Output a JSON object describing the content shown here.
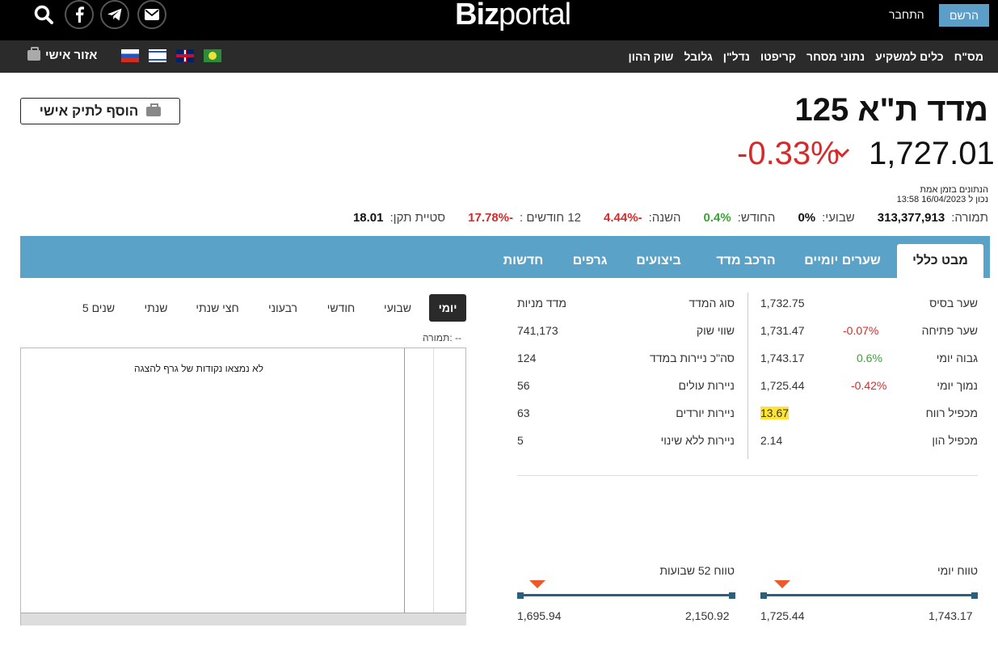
{
  "header": {
    "logo_bold": "Biz",
    "logo_light": "portal",
    "login": "התחבר",
    "register": "הרשם",
    "icons": [
      "search-icon",
      "facebook-icon",
      "telegram-icon",
      "email-icon"
    ]
  },
  "nav": {
    "items": [
      "שוק ההון",
      "גלובל",
      "נדל\"ן",
      "קריפטו",
      "נתוני מסחר",
      "כלים למשקיע",
      "מס\"ח"
    ],
    "personal_area": "אזור אישי"
  },
  "title": {
    "name": "מדד ת\"א 125",
    "add_portfolio": "הוסף לתיק אישי",
    "price": "1,727.01",
    "change": "-0.33%",
    "realtime_line1": "הנתונים בזמן אמת",
    "realtime_line2": "נכון ל 16/04/2023 13:58"
  },
  "stats": {
    "volume_label": "תמורה:",
    "volume": "313,377,913",
    "weekly_label": "שבועי:",
    "weekly": "0%",
    "monthly_label": "החודש:",
    "monthly": "0.4%",
    "year_label": "השנה:",
    "year": "-4.44%",
    "months12_label": "12 חודשים :",
    "months12": "-17.78%",
    "stddev_label": "סטיית תקן:",
    "stddev": "18.01"
  },
  "tabs": [
    "מבט כללי",
    "שערים יומיים",
    "הרכב מדד",
    "ביצועים",
    "גרפים",
    "חדשות"
  ],
  "chart": {
    "periods": [
      "יומי",
      "שבועי",
      "חודשי",
      "רבעוני",
      "חצי שנתי",
      "שנתי",
      "5 שנים"
    ],
    "volume_label": "תמורה: --",
    "no_data": "לא נמצאו נקודות של גרף להצגה"
  },
  "table_right": [
    {
      "label": "שער בסיס",
      "value": "1,732.75",
      "change": ""
    },
    {
      "label": "שער פתיחה",
      "value": "1,731.47",
      "change": "-0.07%"
    },
    {
      "label": "גבוה יומי",
      "value": "1,743.17",
      "change": "0.6%"
    },
    {
      "label": "נמוך יומי",
      "value": "1,725.44",
      "change": "-0.42%"
    },
    {
      "label": "מכפיל רווח",
      "value": "13.67",
      "change": ""
    },
    {
      "label": "מכפיל הון",
      "value": "2.14",
      "change": ""
    }
  ],
  "table_left": [
    {
      "label": "סוג המדד",
      "value": "מדד מניות"
    },
    {
      "label": "שווי שוק",
      "value": "741,173"
    },
    {
      "label": "סה\"כ ניירות במדד",
      "value": "124"
    },
    {
      "label": "ניירות עולים",
      "value": "56"
    },
    {
      "label": "ניירות יורדים",
      "value": "63"
    },
    {
      "label": "ניירות ללא שינוי",
      "value": "5"
    }
  ],
  "ranges": {
    "daily_title": "טווח יומי",
    "daily_low": "1,725.44",
    "daily_high": "1,743.17",
    "week52_title": "טווח 52 שבועות",
    "week52_low": "1,695.94",
    "week52_high": "2,150.92"
  },
  "colors": {
    "accent_blue": "#5ba2c9",
    "negative": "#d62a2a",
    "positive": "#3aa335",
    "marker": "#ea5a2b"
  }
}
